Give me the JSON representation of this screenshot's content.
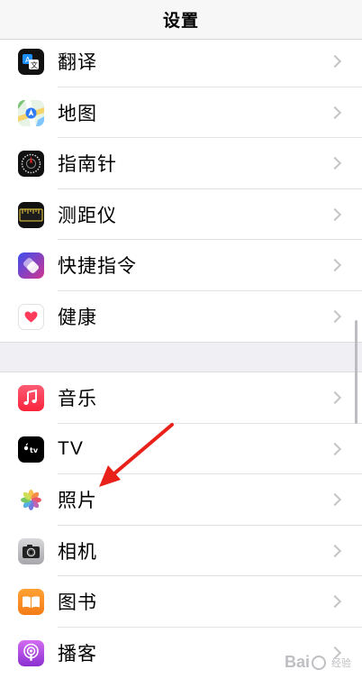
{
  "header": {
    "title": "设置"
  },
  "group_a": [
    {
      "label": "翻译",
      "icon": "translate-icon"
    },
    {
      "label": "地图",
      "icon": "maps-icon"
    },
    {
      "label": "指南针",
      "icon": "compass-icon"
    },
    {
      "label": "测距仪",
      "icon": "measure-icon"
    },
    {
      "label": "快捷指令",
      "icon": "shortcuts-icon"
    },
    {
      "label": "健康",
      "icon": "health-icon"
    }
  ],
  "group_b": [
    {
      "label": "音乐",
      "icon": "music-icon"
    },
    {
      "label": "TV",
      "icon": "tv-icon"
    },
    {
      "label": "照片",
      "icon": "photos-icon"
    },
    {
      "label": "相机",
      "icon": "camera-icon"
    },
    {
      "label": "图书",
      "icon": "books-icon"
    },
    {
      "label": "播客",
      "icon": "podcasts-icon"
    }
  ],
  "watermark": {
    "brand": "Bai",
    "suffix": "经验"
  },
  "colors": {
    "annotation_arrow": "#e8211a",
    "chevron": "#c4c4c7"
  }
}
